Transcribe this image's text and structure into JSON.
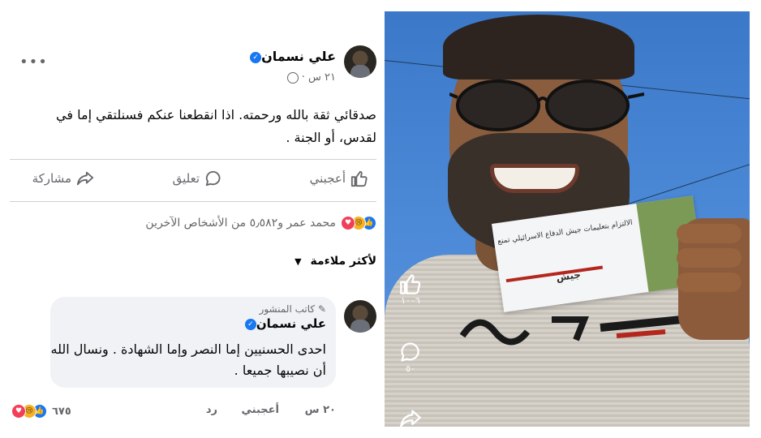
{
  "post": {
    "author": "علي نسمان",
    "time": "٢١ س ·",
    "text_line1": "صدقائي ثقة بالله ورحمته. اذا انقطعنا عنكم فسنلتقي إما في",
    "text_line2": "لقدس، أو الجنة .",
    "more_icon": "more-dots-icon"
  },
  "actions": {
    "like": "أعجبني",
    "comment": "تعليق",
    "share": "مشاركة"
  },
  "reactions": {
    "summary": "محمد عمر و٥٫٥٨٢ من الأشخاص الآخرين"
  },
  "sort": {
    "label": "لأكثر ملاءمة"
  },
  "comment": {
    "author_tag": "كاتب المنشور",
    "author": "علي نسمان",
    "line1": "احدى الحسنيين إما النصر وإما الشهادة . ونسال الله",
    "line2": "أن نصيبها جميعا .",
    "time": "٢٠ س",
    "like": "أعجبني",
    "reply": "رد",
    "reaction_count": "٦٧٥"
  },
  "reel": {
    "like_count": "١٠٠٦",
    "comment_count": "٥٠"
  },
  "photo": {
    "card_text": "الالتزام بتعليمات جيش الدفاع الاسرائيلي تمنع",
    "card_logo": "جيش"
  },
  "colors": {
    "facebook_blue": "#1877f2",
    "gray_text": "#65676b",
    "bubble_bg": "#f0f2f5"
  }
}
